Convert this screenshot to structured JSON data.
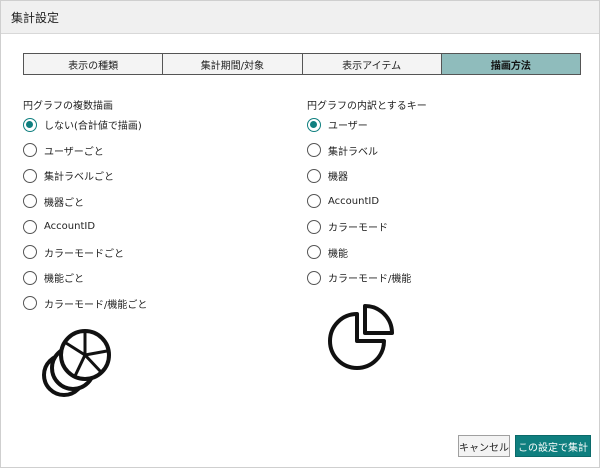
{
  "dialog": {
    "title": "集計設定"
  },
  "tabs": [
    {
      "label": "表示の種類",
      "active": false
    },
    {
      "label": "集計期間/対象",
      "active": false
    },
    {
      "label": "表示アイテム",
      "active": false
    },
    {
      "label": "描画方法",
      "active": true
    }
  ],
  "left_group": {
    "title": "円グラフの複数描画",
    "options": [
      {
        "label": "しない(合計値で描画)",
        "checked": true
      },
      {
        "label": "ユーザーごと",
        "checked": false
      },
      {
        "label": "集計ラベルごと",
        "checked": false
      },
      {
        "label": "機器ごと",
        "checked": false
      },
      {
        "label": "AccountID",
        "checked": false
      },
      {
        "label": "カラーモードごと",
        "checked": false
      },
      {
        "label": "機能ごと",
        "checked": false
      },
      {
        "label": "カラーモード/機能ごと",
        "checked": false
      }
    ],
    "icon": "stacked-pie-charts-icon"
  },
  "right_group": {
    "title": "円グラフの内訳とするキー",
    "options": [
      {
        "label": "ユーザー",
        "checked": true
      },
      {
        "label": "集計ラベル",
        "checked": false
      },
      {
        "label": "機器",
        "checked": false
      },
      {
        "label": "AccountID",
        "checked": false
      },
      {
        "label": "カラーモード",
        "checked": false
      },
      {
        "label": "機能",
        "checked": false
      },
      {
        "label": "カラーモード/機能",
        "checked": false
      }
    ],
    "icon": "pie-chart-icon"
  },
  "buttons": {
    "cancel": "キャンセル",
    "apply": "この設定で集計"
  },
  "colors": {
    "accent": "#0f7f7f",
    "active_tab": "#8fbcbc"
  }
}
